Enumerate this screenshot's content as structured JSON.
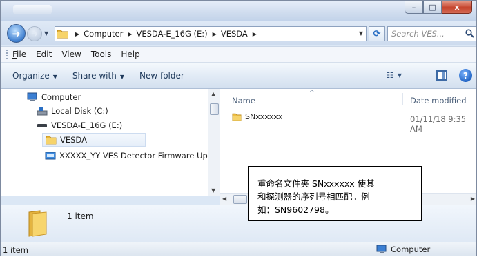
{
  "window": {
    "caption_buttons": {
      "minimize": "–",
      "maximize": "□",
      "close": "x"
    }
  },
  "address_bar": {
    "path": [
      "Computer",
      "VESDA-E_16G (E:)",
      "VESDA"
    ],
    "search_placeholder": "Search VES..."
  },
  "menu": [
    "File",
    "Edit",
    "View",
    "Tools",
    "Help"
  ],
  "commands": {
    "organize": "Organize",
    "share_with": "Share with",
    "new_folder": "New folder"
  },
  "nav_tree": [
    {
      "label": "Computer",
      "icon": "computer-icon"
    },
    {
      "label": "Local Disk (C:)",
      "icon": "hard-drive-icon"
    },
    {
      "label": "VESDA-E_16G (E:)",
      "icon": "usb-drive-icon"
    },
    {
      "label": "VESDA",
      "icon": "folder-icon",
      "selected": true
    },
    {
      "label": "XXXXX_YY VES Detector Firmware Upgrad",
      "icon": "installer-icon"
    }
  ],
  "columns": {
    "name": "Name",
    "date_modified": "Date modified"
  },
  "files": [
    {
      "name": "SNxxxxxx",
      "date": "01/11/18 9:35 AM"
    }
  ],
  "details": {
    "count": "1 item"
  },
  "status": {
    "left": "1 item",
    "right": "Computer"
  },
  "callout": {
    "text": "重命名文件夹 SNxxxxxx 使其\n和探测器的序列号相匹配。例\n如：SN9602798。"
  },
  "colors": {
    "accent": "#2a6fc4",
    "folder": "#f0c24a",
    "frame": "#dbe7f5"
  }
}
